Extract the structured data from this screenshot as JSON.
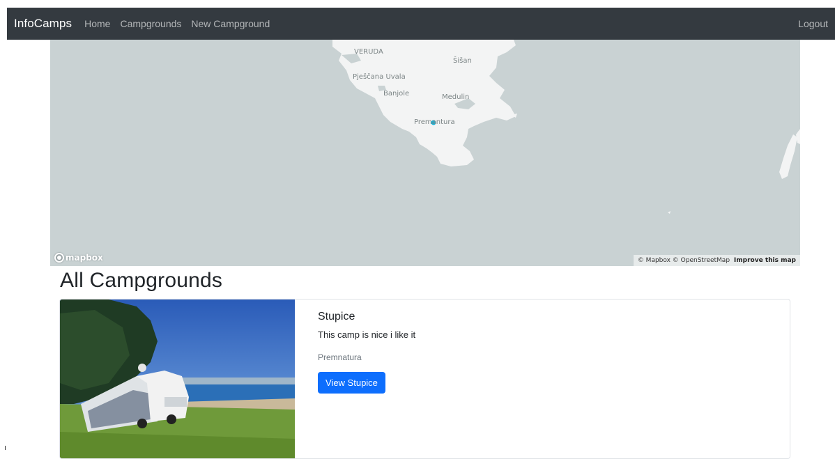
{
  "navbar": {
    "brand": "InfoCamps",
    "links": [
      "Home",
      "Campgrounds",
      "New Campground"
    ],
    "logout": "Logout"
  },
  "map": {
    "labels": [
      "VERUDA",
      "Šišan",
      "Pješčana Uvala",
      "Banjole",
      "Medulin",
      "Premantura"
    ],
    "logo_text": "mapbox",
    "attribution": "© Mapbox © OpenStreetMap",
    "improve_link": "Improve this map",
    "marker_color": "#11b4da",
    "water_color": "#c9d2d3",
    "land_color": "#f3f4f4"
  },
  "page": {
    "title": "All Campgrounds"
  },
  "campgrounds": [
    {
      "title": "Stupice",
      "description": "This camp is nice i like it",
      "location": "Premnatura",
      "button_label": "View Stupice"
    }
  ],
  "colors": {
    "navbar_bg": "#343a40",
    "primary": "#0d6efd"
  }
}
